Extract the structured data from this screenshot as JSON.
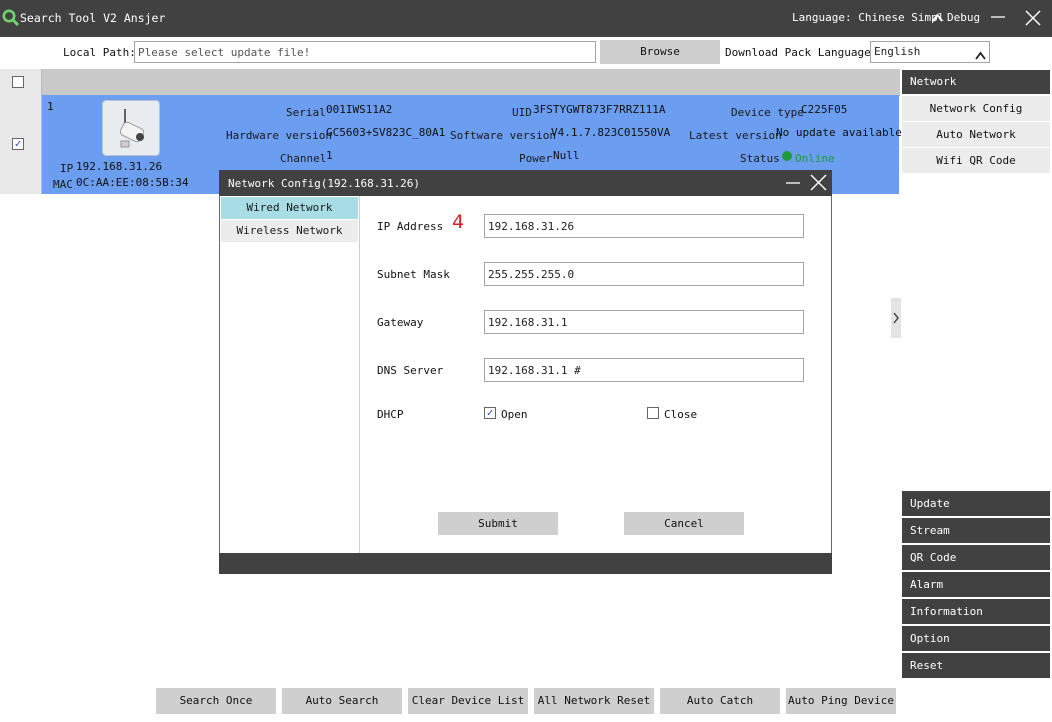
{
  "window": {
    "title": "Search Tool V2 Ansjer",
    "language_label": "Language: Chinese Simpl",
    "debug_label": "Debug"
  },
  "toolbar": {
    "local_path_label": "Local Path:",
    "local_path_placeholder": "Please select update file!",
    "browse_label": "Browse",
    "download_pack_label": "Download Pack Language:",
    "download_pack_value": "English"
  },
  "device": {
    "index": "1",
    "ip_label": "IP",
    "ip": "192.168.31.26",
    "mac_label": "MAC",
    "mac": "0C:AA:EE:08:5B:34",
    "serial_label": "Serial",
    "serial": "001IWS11A2",
    "uid_label": "UID",
    "uid": "3FSTYGWT873F7RRZ111A",
    "device_type_label": "Device type",
    "device_type": "C225F05",
    "hardware_label": "Hardware version",
    "hardware": "GC5603+SV823C_80A1",
    "software_label": "Software version",
    "software": "V4.1.7.823C01550VA",
    "latest_label": "Latest version",
    "latest": "No update available",
    "channel_label": "Channel",
    "channel": "1",
    "power_label": "Power",
    "power": "Null",
    "status_label": "Status",
    "status": "Online",
    "status_color": "#1f9a3a"
  },
  "right_panel": {
    "network_header": "Network",
    "network_items": [
      "Network Config",
      "Auto Network",
      "Wifi QR Code"
    ],
    "actions": [
      "Update",
      "Stream",
      "QR Code",
      "Alarm",
      "Information",
      "Option",
      "Reset"
    ]
  },
  "dialog": {
    "title": "Network Config(192.168.31.26)",
    "tabs": [
      "Wired Network",
      "Wireless Network"
    ],
    "ip_label": "IP Address",
    "ip_value": "192.168.31.26",
    "annotation": "4",
    "subnet_label": "Subnet Mask",
    "subnet_value": "255.255.255.0",
    "gateway_label": "Gateway",
    "gateway_value": "192.168.31.1",
    "dns_label": "DNS Server",
    "dns_value": "192.168.31.1 #",
    "dhcp_label": "DHCP",
    "open_label": "Open",
    "close_label": "Close",
    "submit_label": "Submit",
    "cancel_label": "Cancel"
  },
  "bottom_buttons": [
    "Search Once",
    "Auto Search",
    "Clear Device List",
    "All Network Reset",
    "Auto Catch",
    "Auto Ping Device"
  ],
  "colors": {
    "titlebar": "#414141",
    "selected_row": "#6b9df0",
    "active_tab": "#a9dde6",
    "annotation": "#e21f1f"
  }
}
